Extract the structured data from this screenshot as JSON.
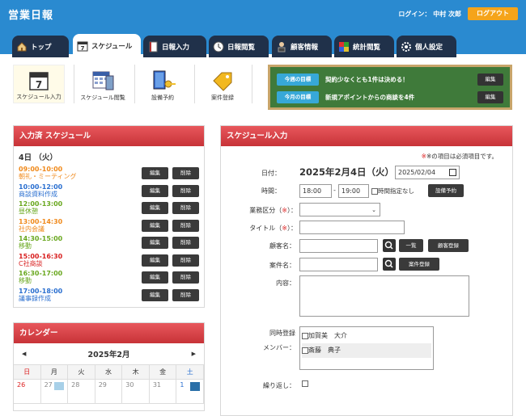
{
  "header": {
    "title": "営業日報",
    "login_text": "ログイン： 中村 次郎",
    "logout_label": "ログアウト"
  },
  "tabs": [
    {
      "label": "トップ",
      "icon": "home-icon"
    },
    {
      "label": "スケジュール",
      "icon": "calendar-icon",
      "active": true
    },
    {
      "label": "日報入力",
      "icon": "notebook-icon"
    },
    {
      "label": "日報閲覧",
      "icon": "clock-icon"
    },
    {
      "label": "顧客情報",
      "icon": "person-icon"
    },
    {
      "label": "統計閲覧",
      "icon": "blocks-icon"
    },
    {
      "label": "個人設定",
      "icon": "gear-icon"
    }
  ],
  "icon_buttons": [
    {
      "label": "スケジュール入力",
      "icon": "calendar-7-icon",
      "selected": true
    },
    {
      "label": "スケジュール閲覧",
      "icon": "calendar-book-icon"
    },
    {
      "label": "設備予約",
      "icon": "door-key-icon"
    },
    {
      "label": "案件登録",
      "icon": "tag-icon"
    }
  ],
  "goals": [
    {
      "label": "今週の目標",
      "text": "契約少なくとも1件は決める！",
      "edit": "編集"
    },
    {
      "label": "今月の目標",
      "text": "新規アポイントからの商談を4件",
      "edit": "編集"
    }
  ],
  "schedule_panel": {
    "title": "入力済 スケジュール",
    "date": "4日 （火）",
    "edit_label": "編集",
    "delete_label": "削除",
    "items": [
      {
        "time": "09:00-10:00",
        "text": "朝礼・ミーティング",
        "color": "#f08a1c"
      },
      {
        "time": "10:00-12:00",
        "text": "商談資料作成",
        "color": "#2a6fd0"
      },
      {
        "time": "12:00-13:00",
        "text": "昼休憩",
        "color": "#6aa820"
      },
      {
        "time": "13:00-14:30",
        "text": "社内会議",
        "color": "#f08a1c"
      },
      {
        "time": "14:30-15:00",
        "text": "移動",
        "color": "#6aa820"
      },
      {
        "time": "15:00-16:30",
        "text": "C社商談",
        "color": "#d82020"
      },
      {
        "time": "16:30-17:00",
        "text": "移動",
        "color": "#6aa820"
      },
      {
        "time": "17:00-18:00",
        "text": "議事録作成",
        "color": "#2a6fd0"
      }
    ]
  },
  "calendar": {
    "title": "カレンダー",
    "month": "2025年2月",
    "prev": "◀",
    "next": "▶",
    "weekdays": [
      "日",
      "月",
      "火",
      "水",
      "木",
      "金",
      "土"
    ],
    "days": [
      "26",
      "27",
      "28",
      "29",
      "30",
      "31",
      "1"
    ]
  },
  "form": {
    "title": "スケジュール入力",
    "required_note": "※の項目は必須項目です。",
    "date_label": "日付：",
    "date_display": "2025年2月4日（火）",
    "date_value": "2025/02/04",
    "time_label": "時間：",
    "time_start": "18:00",
    "time_sep": "-",
    "time_end": "19:00",
    "no_time_label": "時間指定なし",
    "equipment_button": "設備予約",
    "category_label": "業務区分（",
    "category_label_end": "）：",
    "title_label": "タイトル（",
    "title_label_end": "）：",
    "req_mark": "※",
    "customer_label": "顧客名：",
    "list_button": "一覧",
    "customer_register_button": "顧客登録",
    "project_label": "案件名：",
    "project_register_button": "案件登録",
    "content_label": "内容：",
    "members_label_1": "同時登録",
    "members_label_2": "メンバー：",
    "members": [
      "加賀美　大介",
      "斎藤　典子"
    ],
    "repeat_label": "繰り返し："
  }
}
